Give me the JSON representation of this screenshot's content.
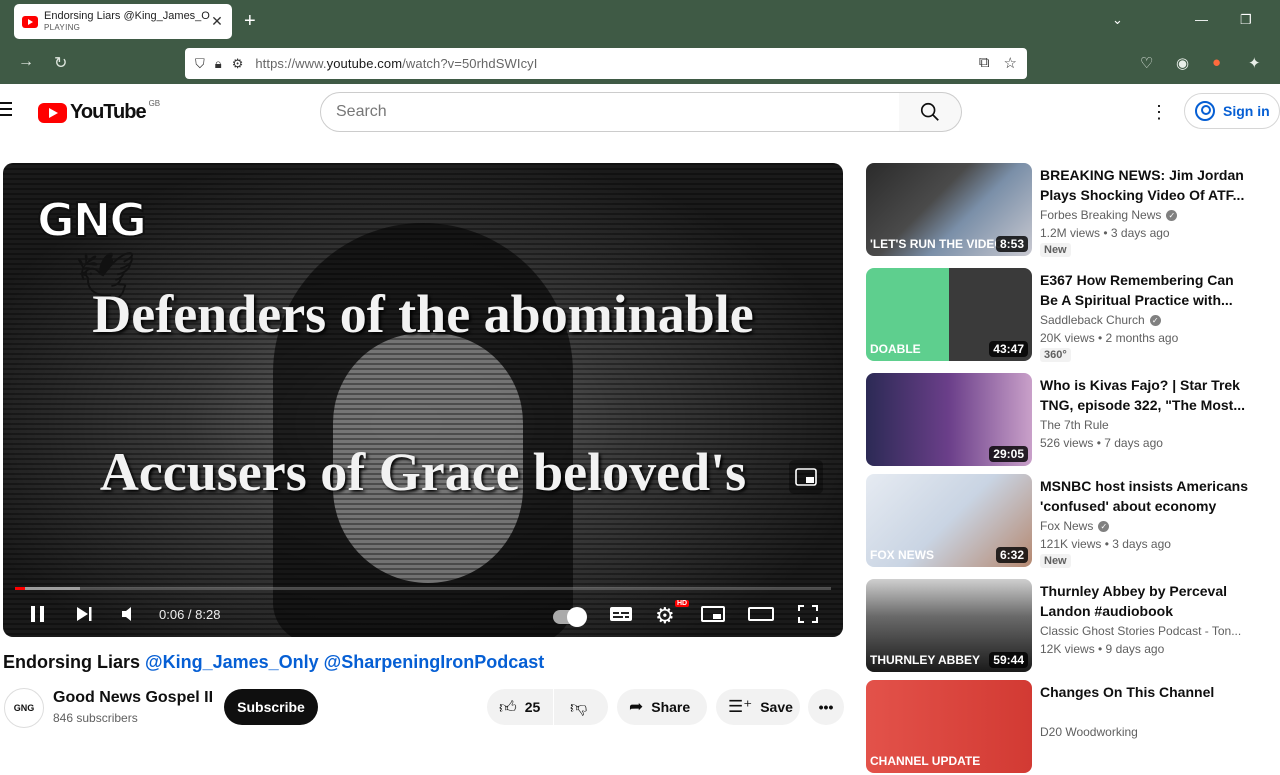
{
  "browser": {
    "tab_title": "Endorsing Liars @King_James_O",
    "tab_status": "PLAYING",
    "url_prefix": "https://www.",
    "url_host": "youtube.com",
    "url_path": "/watch?v=50rhdSWIcyI"
  },
  "header": {
    "logo_text": "YouTube",
    "country": "GB",
    "search_placeholder": "Search",
    "sign_in": "Sign in"
  },
  "player": {
    "overlay_line1": "Defenders of the abominable",
    "overlay_line2": "Accusers of Grace beloved's",
    "watermark": "GNG",
    "time": "0:06 / 8:28",
    "progress_played": 0.012,
    "progress_buffered": 0.08,
    "hd_badge": "HD"
  },
  "video": {
    "title_main": "Endorsing Liars ",
    "title_tags": "@King_James_Only @SharpeningIronPodcast",
    "channel": "Good News Gospel II",
    "subscribers": "846 subscribers",
    "avatar_text": "GNG",
    "subscribe": "Subscribe",
    "likes": "25",
    "share": "Share",
    "save": "Save"
  },
  "recommendations": [
    {
      "title": "BREAKING NEWS: Jim Jordan Plays Shocking Video Of ATF...",
      "channel": "Forbes Breaking News",
      "verified": true,
      "meta": "1.2M views • 3 days ago",
      "badge": "New",
      "duration": "8:53",
      "caption": "'LET'S RUN THE VIDEO"
    },
    {
      "title": "E367 How Remembering Can Be A Spiritual Practice with...",
      "channel": "Saddleback Church",
      "verified": true,
      "meta": "20K views • 2 months ago",
      "badge": "360°",
      "duration": "43:47",
      "caption": "DOABLE"
    },
    {
      "title": "Who is Kivas Fajo? | Star Trek TNG, episode 322, \"The Most...",
      "channel": "The 7th Rule",
      "verified": false,
      "meta": "526 views • 7 days ago",
      "badge": "",
      "duration": "29:05",
      "caption": ""
    },
    {
      "title": "MSNBC host insists Americans 'confused' about economy",
      "channel": "Fox News",
      "verified": true,
      "meta": "121K views • 3 days ago",
      "badge": "New",
      "duration": "6:32",
      "caption": "FOX NEWS"
    },
    {
      "title": "Thurnley Abbey by Perceval Landon #audiobook",
      "channel": "Classic Ghost Stories Podcast - Ton...",
      "verified": false,
      "meta": "12K views • 9 days ago",
      "badge": "",
      "duration": "59:44",
      "caption": "THURNLEY ABBEY"
    },
    {
      "title": "Changes On This Channel",
      "channel": "D20 Woodworking",
      "verified": false,
      "meta": "",
      "badge": "",
      "duration": "",
      "caption": "CHANNEL UPDATE"
    }
  ]
}
